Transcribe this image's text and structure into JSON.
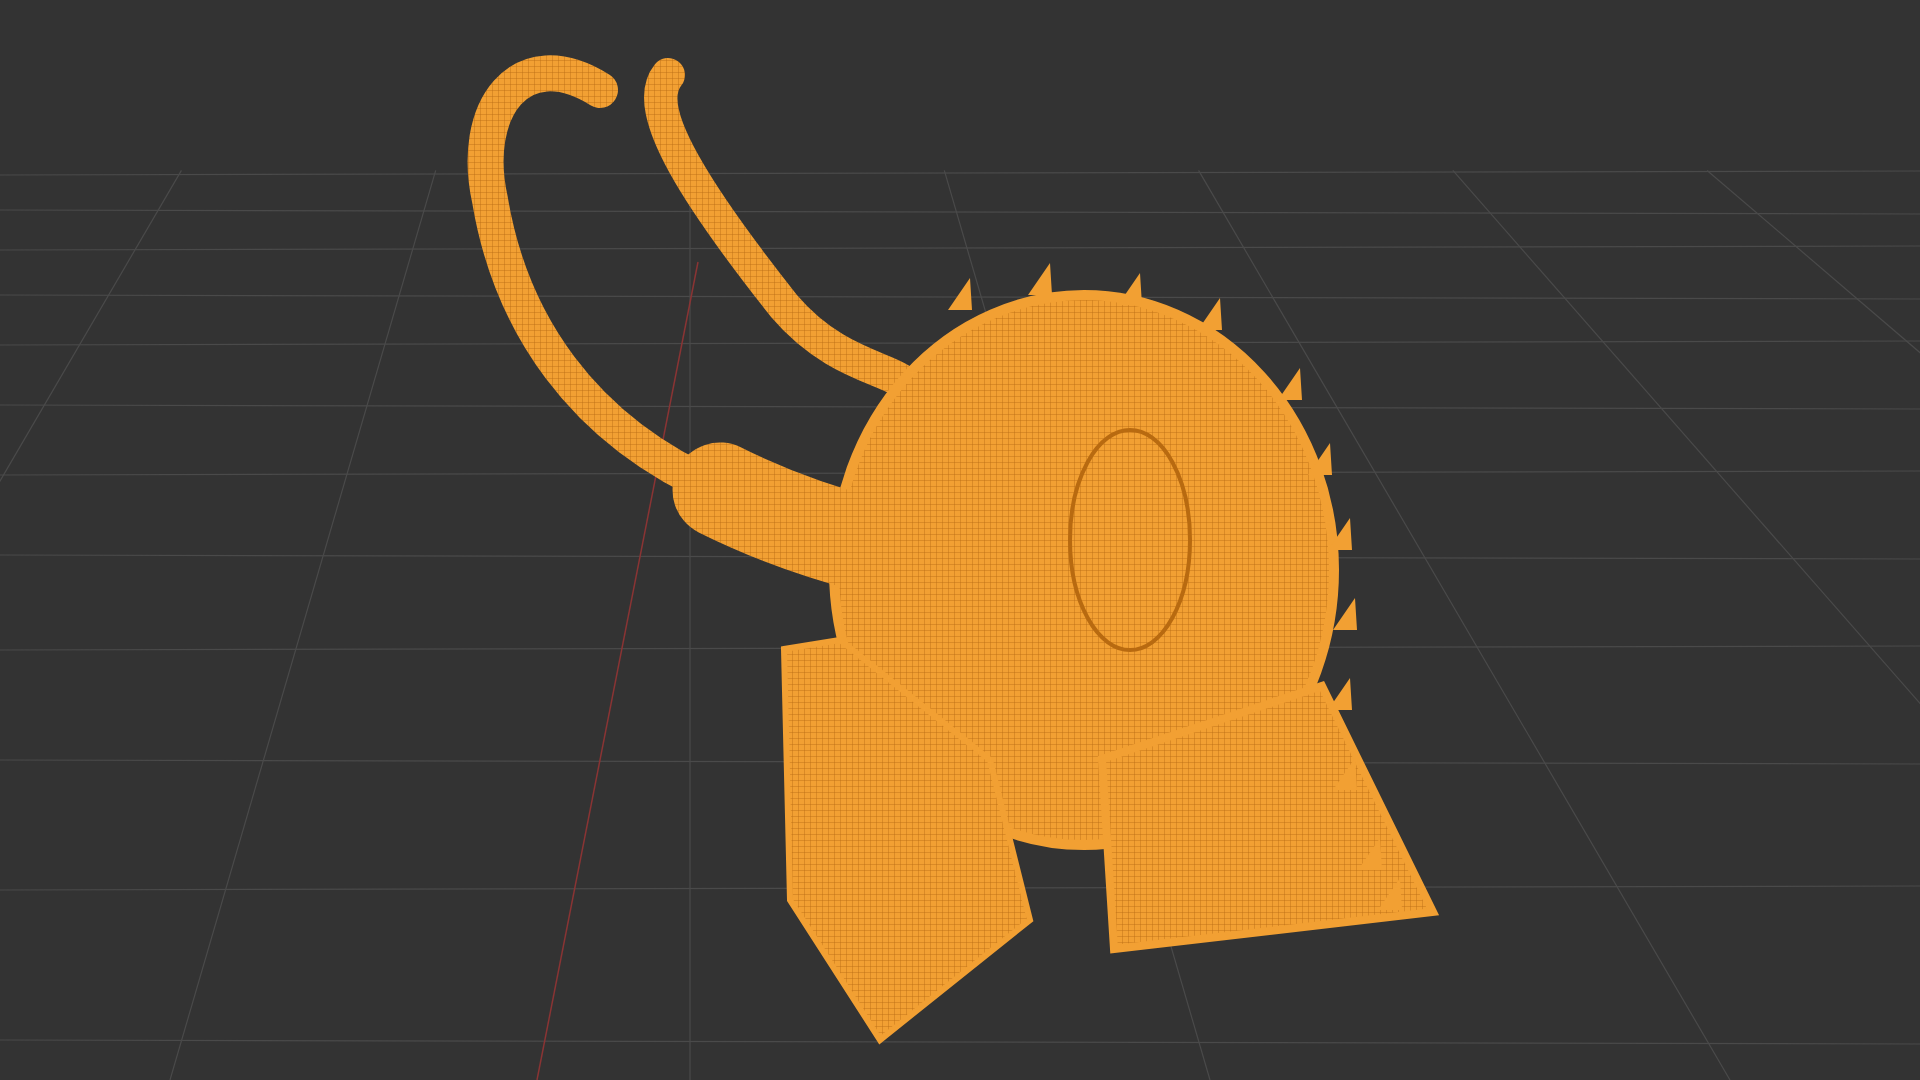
{
  "viewport": {
    "show_floor_grid": true,
    "show_x_axis": true
  },
  "object": {
    "selected": true
  }
}
